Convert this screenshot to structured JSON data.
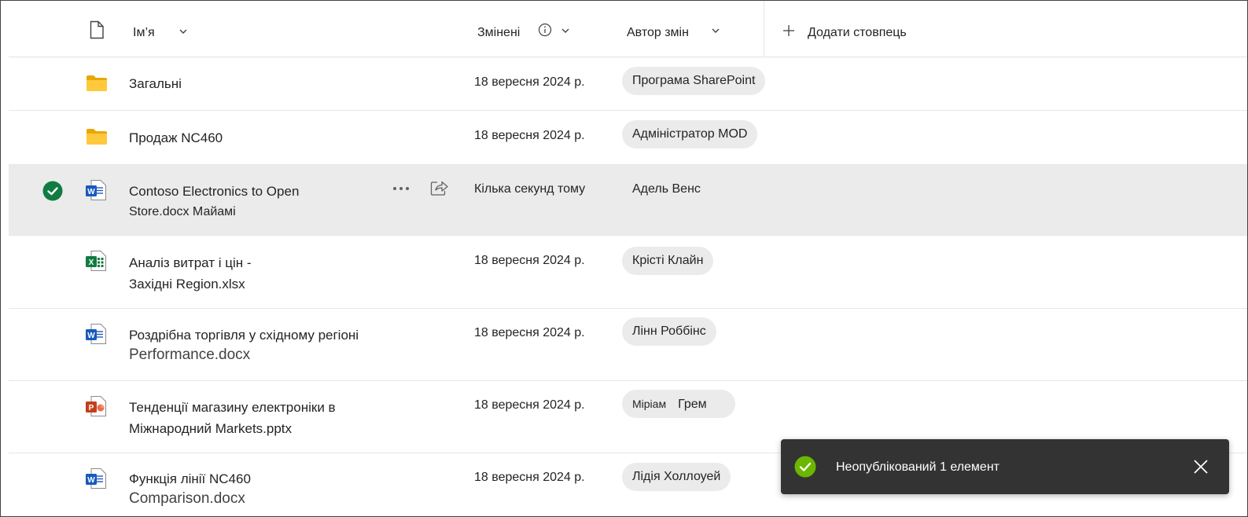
{
  "header": {
    "name_label": "Ім’я",
    "modified_label": "Змінені",
    "author_label": "Автор змін",
    "add_column_label": "Додати стовпець"
  },
  "rows": [
    {
      "type": "folder",
      "name_line1": "Загальні",
      "name_line2": "",
      "modified": "18 вересня 2024 р.",
      "author": "Програма SharePoint"
    },
    {
      "type": "folder",
      "name_line1": "Продаж NC460",
      "name_line2": "",
      "modified": "18 вересня 2024 р.",
      "author": "Адміністратор MOD"
    },
    {
      "type": "word",
      "name_line1": "Contoso Electronics to Open",
      "name_line2": "Store.docx Майамі",
      "modified": "Кілька секунд тому",
      "author": "Адель Венс",
      "selected": true
    },
    {
      "type": "excel",
      "name_line1": "Аналіз витрат і цін -",
      "name_line2": "Західні Region.xlsx",
      "modified": "18 вересня 2024 р.",
      "author": "Крісті Клайн"
    },
    {
      "type": "word",
      "name_line1": "Роздрібна торгівля у східному регіоні",
      "name_line2": "Performance.docx",
      "modified": "18 вересня 2024 р.",
      "author": "Лінн Роббінс"
    },
    {
      "type": "powerpoint",
      "name_line1": "Тенденції магазину електроніки в",
      "name_line2": "Міжнародний Markets.pptx",
      "modified": "18 вересня 2024 р.",
      "author_part1": "Міріам",
      "author_part2": "Грем"
    },
    {
      "type": "word",
      "name_line1": "Функція лінії NC460",
      "name_line2": "Comparison.docx",
      "modified": "18 вересня 2024 р.",
      "author": "Лідія Холлоуей"
    }
  ],
  "toast": {
    "message": "Неопублікований 1 елемент"
  },
  "colors": {
    "accent_green": "#6bb700",
    "selected_check": "#107c41",
    "folder": "#ffc83d",
    "word": "#185abd",
    "excel": "#107c41",
    "powerpoint": "#c43e1c"
  }
}
